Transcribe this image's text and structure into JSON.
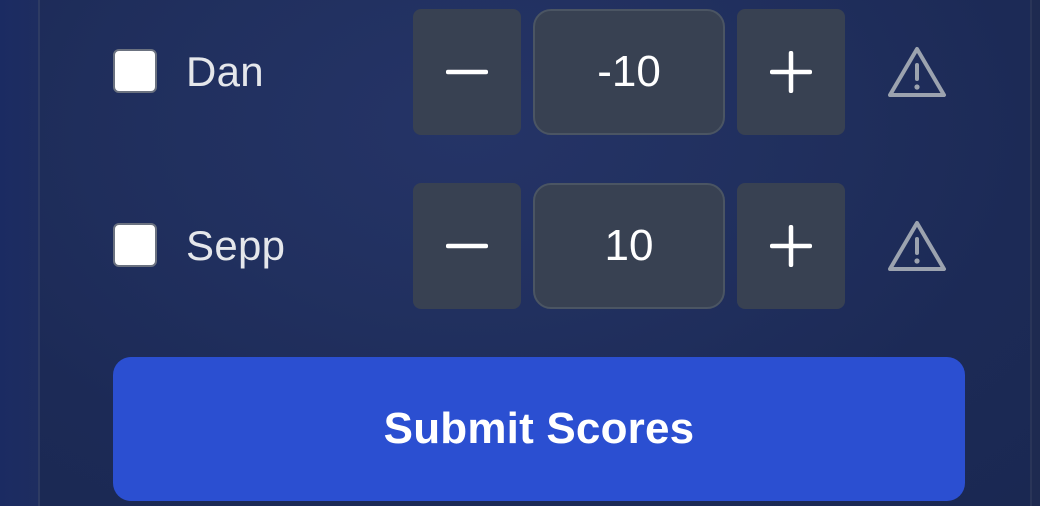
{
  "players": [
    {
      "name": "Dan",
      "checked": false,
      "score": "-10",
      "minus_icon": "minus-icon",
      "plus_icon": "plus-icon",
      "warning_icon": "warning-triangle-icon"
    },
    {
      "name": "Sepp",
      "checked": false,
      "score": "10",
      "minus_icon": "minus-icon",
      "plus_icon": "plus-icon",
      "warning_icon": "warning-triangle-icon"
    }
  ],
  "submit": {
    "label": "Submit Scores"
  },
  "colors": {
    "background": "#21305f",
    "control": "#384152",
    "control_border": "#4b5563",
    "accent": "#2b4fd1",
    "text": "#e5e7eb",
    "warning_icon": "#9ca3af"
  }
}
